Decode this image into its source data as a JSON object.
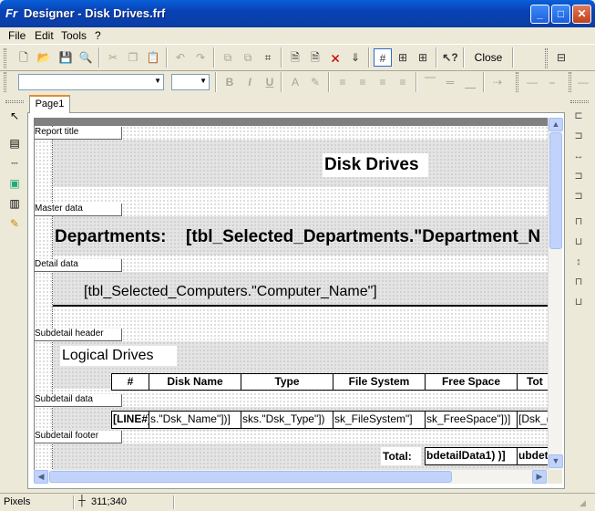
{
  "window": {
    "app_icon": "Fr",
    "title": "Designer - Disk Drives.frf",
    "minimize": "_",
    "maximize": "□",
    "close": "✕"
  },
  "menu": [
    "File",
    "Edit",
    "Tools",
    "?"
  ],
  "toolbar": {
    "close_label": "Close"
  },
  "tabs": [
    "Page1"
  ],
  "report": {
    "bands": {
      "report_title": "Report title",
      "master_data": "Master data",
      "detail_data": "Detail data",
      "subdetail_header": "Subdetail header",
      "subdetail_data": "Subdetail data",
      "subdetail_footer": "Subdetail footer"
    },
    "title_text": "Disk Drives",
    "departments_label": "Departments:",
    "department_field": "[tbl_Selected_Departments.\"Department_N",
    "computer_field": "[tbl_Selected_Computers.\"Computer_Name\"]",
    "logical_drives": "Logical Drives",
    "columns": [
      "#",
      "Disk Name",
      "Type",
      "File System",
      "Free Space",
      "Tot"
    ],
    "data_cells": [
      "[LINE#]",
      "s.\"Dsk_Name\"])]",
      "sks.\"Dsk_Type\"])",
      "sk_FileSystem\"]",
      "sk_FreeSpace\"])]",
      "[Dsk_("
    ],
    "total_label": "Total:",
    "footer_cells": [
      "bdetailData1) )]",
      "ubdet"
    ]
  },
  "status": {
    "units": "Pixels",
    "coords": "311;340"
  }
}
